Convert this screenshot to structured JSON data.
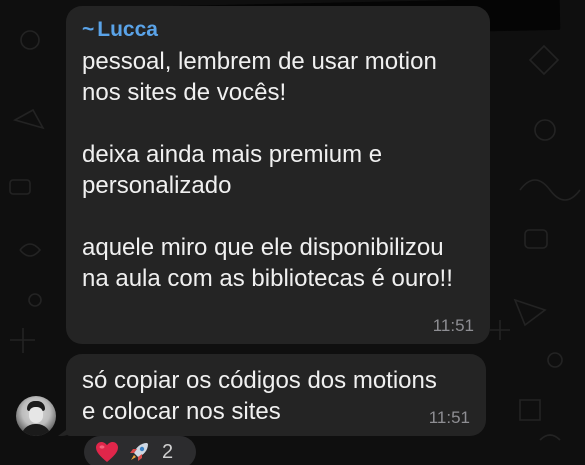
{
  "chat": {
    "messages": [
      {
        "sender": {
          "tilde": "~",
          "name": "Lucca"
        },
        "lines": [
          "pessoal, lembrem de usar motion",
          "nos sites de vocês!",
          "",
          "deixa ainda mais premium e",
          "personalizado",
          "",
          "aquele miro que ele disponibilizou",
          "na aula com as bibliotecas é ouro!!"
        ],
        "time": "11:51"
      },
      {
        "lines": [
          "só copiar os códigos dos motions",
          "e colocar nos sites"
        ],
        "time": "11:51"
      }
    ],
    "reactions": {
      "icons": [
        "heart-icon",
        "rocket-icon"
      ],
      "count": "2"
    },
    "colors": {
      "background": "#0f0f0f",
      "bubble": "#242424",
      "sender_name": "#5aa3e8",
      "timestamp": "#8e8e93",
      "reaction_pill": "#2c2c2e"
    }
  }
}
